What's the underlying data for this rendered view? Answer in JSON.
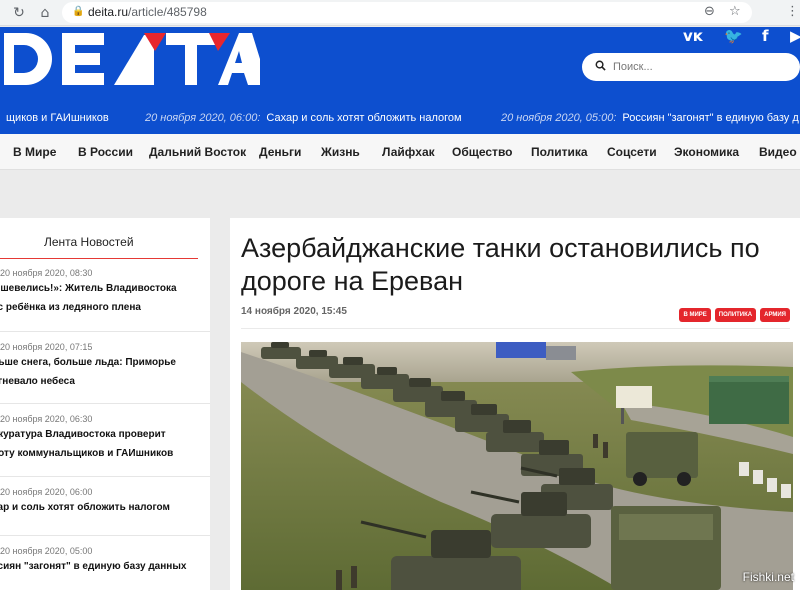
{
  "browser": {
    "url_host": "deita.ru",
    "url_path": "/article/485798"
  },
  "site": {
    "logo": "DEITA",
    "search_placeholder": "Поиск...",
    "brand_color": "#0d4fcf",
    "accent_color": "#e4262c"
  },
  "ticker": [
    {
      "date": "",
      "text": "щиков и ГАИшников"
    },
    {
      "date": "20 ноября 2020, 06:00:",
      "text": "Сахар и соль хотят обложить налогом"
    },
    {
      "date": "20 ноября 2020, 05:00:",
      "text": "Россиян \"загонят\" в единую базу д"
    }
  ],
  "menu": [
    "В Мире",
    "В России",
    "Дальний Восток",
    "Деньги",
    "Жизнь",
    "Лайфхак",
    "Общество",
    "Политика",
    "Соцсети",
    "Экономика",
    "Видео"
  ],
  "sidebar": {
    "title": "Лента Новостей",
    "items": [
      {
        "date": "20 ноября 2020, 08:30",
        "line1": "е шевелись!»: Житель Владивостока",
        "line2": "ас ребёнка из ледяного плена"
      },
      {
        "date": "20 ноября 2020, 07:15",
        "line1": "льше снега, больше льда: Приморье",
        "line2": "огневало небеса"
      },
      {
        "date": "20 ноября 2020, 06:30",
        "line1": "окуратура Владивостока проверит",
        "line2": "боту коммунальщиков и ГАИшников"
      },
      {
        "date": "20 ноября 2020, 06:00",
        "line1": "хар и соль хотят обложить налогом",
        "line2": ""
      },
      {
        "date": "20 ноября 2020, 05:00",
        "line1": "ссиян \"загонят\" в единую базу данных",
        "line2": ""
      }
    ]
  },
  "article": {
    "title": "Азербайджанские танки  остановились по дороге на Ереван",
    "date": "14 ноября 2020, 15:45",
    "tags": [
      "В мире",
      "Политика",
      "Армия"
    ]
  },
  "watermark": "Fishki.net"
}
